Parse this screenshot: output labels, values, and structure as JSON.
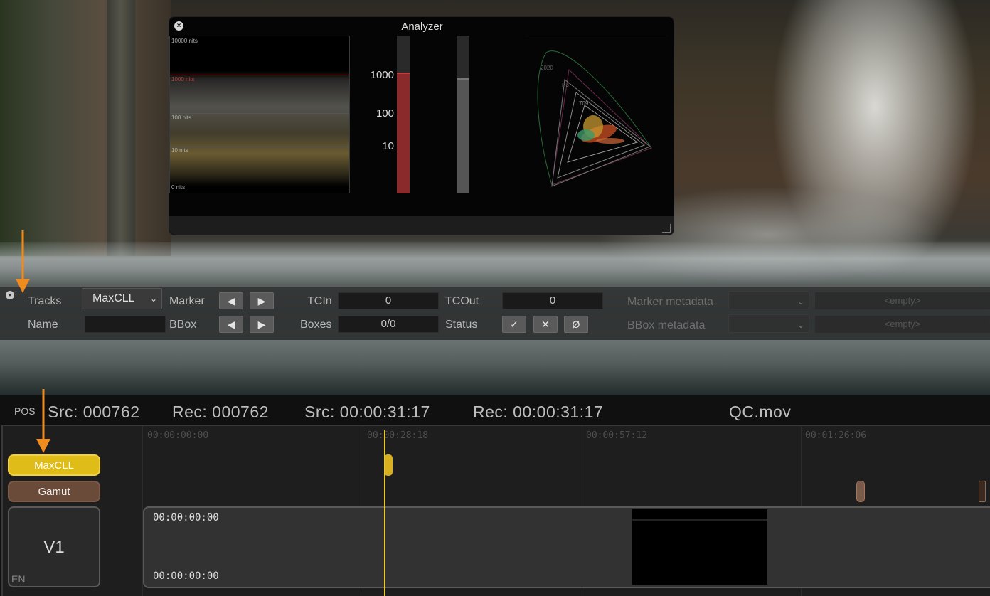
{
  "analyzer": {
    "title": "Analyzer",
    "close_glyph": "×",
    "waveform_labels": [
      "10000 nits",
      "1000 nits",
      "100 nits",
      "10 nits",
      "0 nits"
    ],
    "meter_ticks": [
      "1000",
      "100",
      "10"
    ],
    "gamut_labels": [
      "2020",
      "P3",
      "709"
    ]
  },
  "toolbar": {
    "close_glyph": "×",
    "tracks_label": "Tracks",
    "tracks_value": "MaxCLL",
    "marker_label": "Marker",
    "tcin_label": "TCIn",
    "tcin_value": "0",
    "tcout_label": "TCOut",
    "tcout_value": "0",
    "marker_metadata_label": "Marker metadata",
    "marker_metadata_value": "<empty>",
    "name_label": "Name",
    "name_value": "",
    "bbox_label": "BBox",
    "boxes_label": "Boxes",
    "boxes_value": "0/0",
    "status_label": "Status",
    "bbox_metadata_label": "BBox metadata",
    "bbox_metadata_value": "<empty>",
    "prev_glyph": "◀",
    "next_glyph": "▶",
    "approve_glyph": "✓",
    "reject_glyph": "✕",
    "clear_glyph": "Ø",
    "chevron_glyph": "⌄"
  },
  "statusbar": {
    "pos_label": "POS",
    "src_frame": "Src:  000762",
    "rec_frame": "Rec:  000762",
    "src_tc": "Src:  00:00:31:17",
    "rec_tc": "Rec:  00:00:31:17",
    "filename": "QC.mov"
  },
  "timeline": {
    "ruler": [
      "00:00:00:00",
      "00:00:28:18",
      "00:00:57:12",
      "00:01:26:06"
    ],
    "tracks": [
      "MaxCLL",
      "Gamut"
    ],
    "video_track": "V1",
    "video_lang": "EN",
    "clip_tc_start": "00:00:00:00",
    "clip_tc_end": "00:00:00:00"
  },
  "colors": {
    "maxcll": "#e8c020",
    "gamut": "#6a4a38",
    "playhead": "#e8c830",
    "arrow": "#f08c1e"
  }
}
